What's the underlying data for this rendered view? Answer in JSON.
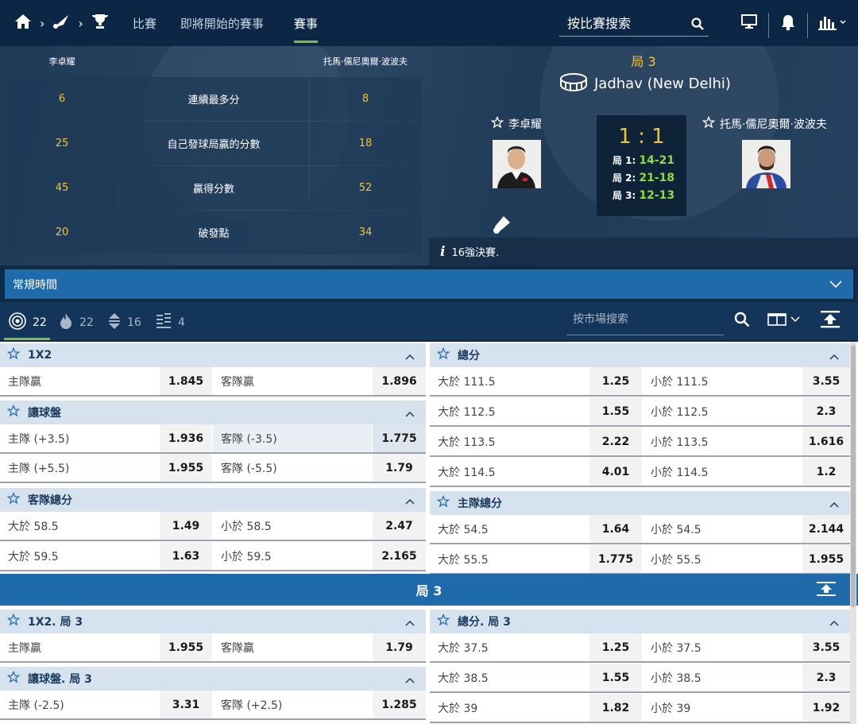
{
  "nav": {
    "tabs": [
      {
        "label": "比賽"
      },
      {
        "label": "即將開始的賽事"
      },
      {
        "label": "賽事"
      }
    ],
    "search_placeholder": "按比賽搜索"
  },
  "stats": {
    "player_left": "李卓耀",
    "player_right": "托馬·儒尼奧爾·波波夫",
    "rows": [
      {
        "left": "6",
        "label": "連續最多分",
        "right": "8"
      },
      {
        "left": "25",
        "label": "自己發球局贏的分數",
        "right": "18"
      },
      {
        "left": "45",
        "label": "贏得分數",
        "right": "52"
      },
      {
        "left": "20",
        "label": "破發點",
        "right": "34"
      }
    ]
  },
  "scoreboard": {
    "set_label": "局 3",
    "venue": "Jadhav (New Delhi)",
    "home": "李卓耀",
    "away": "托馬·儒尼奧爾·波波夫",
    "score": "1 : 1",
    "sets": [
      {
        "label": "局 1:",
        "value": "14-21"
      },
      {
        "label": "局 2:",
        "value": "21-18"
      },
      {
        "label": "局 3:",
        "value": "12-13"
      }
    ],
    "info": "16強決賽."
  },
  "period": {
    "label": "常規時間"
  },
  "filters": {
    "items": [
      {
        "count": "22"
      },
      {
        "count": "22"
      },
      {
        "count": "16"
      },
      {
        "count": "4"
      }
    ],
    "search_placeholder": "按市場搜索"
  },
  "markets": {
    "left": [
      {
        "title": "1X2",
        "rows": [
          {
            "l1": "主隊贏",
            "o1": "1.845",
            "l2": "客隊贏",
            "o2": "1.896"
          }
        ]
      },
      {
        "title": "讓球盤",
        "rows": [
          {
            "l1": "主隊 (+3.5)",
            "o1": "1.936",
            "l2": "客隊 (-3.5)",
            "o2": "1.775"
          },
          {
            "l1": "主隊 (+5.5)",
            "o1": "1.955",
            "l2": "客隊 (-5.5)",
            "o2": "1.79"
          }
        ]
      },
      {
        "title": "客隊總分",
        "rows": [
          {
            "l1": "大於 58.5",
            "o1": "1.49",
            "l2": "小於 58.5",
            "o2": "2.47"
          },
          {
            "l1": "大於 59.5",
            "o1": "1.63",
            "l2": "小於 59.5",
            "o2": "2.165"
          }
        ]
      }
    ],
    "right": [
      {
        "title": "總分",
        "rows": [
          {
            "l1": "大於 111.5",
            "o1": "1.25",
            "l2": "小於 111.5",
            "o2": "3.55"
          },
          {
            "l1": "大於 112.5",
            "o1": "1.55",
            "l2": "小於 112.5",
            "o2": "2.3"
          },
          {
            "l1": "大於 113.5",
            "o1": "2.22",
            "l2": "小於 113.5",
            "o2": "1.616"
          },
          {
            "l1": "大於 114.5",
            "o1": "4.01",
            "l2": "小於 114.5",
            "o2": "1.2"
          }
        ]
      },
      {
        "title": "主隊總分",
        "rows": [
          {
            "l1": "大於 54.5",
            "o1": "1.64",
            "l2": "小於 54.5",
            "o2": "2.144"
          },
          {
            "l1": "大於 55.5",
            "o1": "1.775",
            "l2": "小於 55.5",
            "o2": "1.955"
          }
        ]
      }
    ],
    "section_title": "局 3",
    "left2": [
      {
        "title": "1X2. 局 3",
        "rows": [
          {
            "l1": "主隊贏",
            "o1": "1.955",
            "l2": "客隊贏",
            "o2": "1.79"
          }
        ]
      },
      {
        "title": "讓球盤. 局 3",
        "rows": [
          {
            "l1": "主隊 (-2.5)",
            "o1": "3.31",
            "l2": "客隊 (+2.5)",
            "o2": "1.285"
          }
        ]
      }
    ],
    "right2": [
      {
        "title": "總分. 局 3",
        "rows": [
          {
            "l1": "大於 37.5",
            "o1": "1.25",
            "l2": "小於 37.5",
            "o2": "3.55"
          },
          {
            "l1": "大於 38.5",
            "o1": "1.55",
            "l2": "小於 38.5",
            "o2": "2.3"
          },
          {
            "l1": "大於 39",
            "o1": "1.82",
            "l2": "小於 39",
            "o2": "1.92"
          }
        ]
      }
    ]
  }
}
